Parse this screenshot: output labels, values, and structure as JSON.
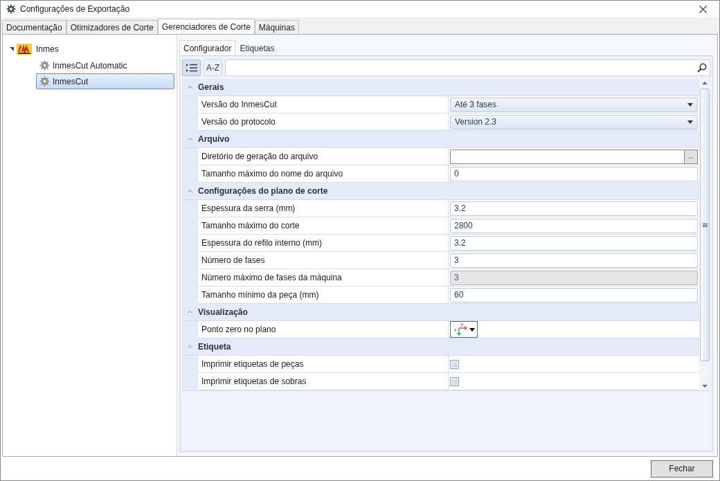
{
  "window": {
    "title": "Configurações de Exportação"
  },
  "tabs": [
    {
      "label": "Documentação",
      "selected": false
    },
    {
      "label": "Otimizadores de Corte",
      "selected": false
    },
    {
      "label": "Gerenciadores de Corte",
      "selected": true
    },
    {
      "label": "Máquinas",
      "selected": false
    }
  ],
  "tree": [
    {
      "label": "Inmes",
      "expanded": true,
      "selected": false,
      "children": [
        {
          "label": "InmesCut Automatic",
          "selected": false
        },
        {
          "label": "InmesCut",
          "selected": true
        }
      ]
    }
  ],
  "inner_tabs": [
    {
      "label": "Configurador",
      "selected": true
    },
    {
      "label": "Etiquetas",
      "selected": false
    }
  ],
  "toolbar": {
    "categorized_selected": true,
    "sort_label": "A-Z"
  },
  "categories": [
    {
      "title": "Gerais",
      "expanded": true,
      "properties": [
        {
          "label": "Versão do InmesCut",
          "kind": "dropdown",
          "value": "Até 3 fases"
        },
        {
          "label": "Versão do protocolo",
          "kind": "dropdown",
          "value": "Version 2.3"
        }
      ]
    },
    {
      "title": "Arquivo",
      "expanded": true,
      "properties": [
        {
          "label": "Diretório de geração do arquivo",
          "kind": "browse",
          "button": "..."
        },
        {
          "label": "Tamanho máximo do nome do arquivo",
          "kind": "text",
          "value": "0",
          "disabled": false
        }
      ]
    },
    {
      "title": "Configurações do plano de corte",
      "expanded": true,
      "properties": [
        {
          "label": "Espessura da serra (mm)",
          "kind": "text",
          "value": "3.2",
          "disabled": false
        },
        {
          "label": "Tamanho máximo do corte",
          "kind": "text",
          "value": "2800",
          "disabled": false
        },
        {
          "label": "Espessura do refilo interno (mm)",
          "kind": "text",
          "value": "3.2",
          "disabled": false
        },
        {
          "label": "Número de fases",
          "kind": "text",
          "value": "3",
          "disabled": false
        },
        {
          "label": "Número máximo de fases da máquina",
          "kind": "text",
          "value": "3",
          "disabled": true
        },
        {
          "label": "Tamanho mínimo da peça (mm)",
          "kind": "text",
          "value": "60",
          "disabled": false
        }
      ]
    },
    {
      "title": "Visualização",
      "expanded": true,
      "properties": [
        {
          "label": "Ponto zero no plano",
          "kind": "axis"
        }
      ]
    },
    {
      "title": "Etiqueta",
      "expanded": true,
      "properties": [
        {
          "label": "Imprimir etiquetas de peças",
          "kind": "checkbox",
          "checked": false
        },
        {
          "label": "Imprimir etiquetas de sobras",
          "kind": "checkbox",
          "checked": false
        }
      ]
    }
  ],
  "close_button": "Fechar"
}
